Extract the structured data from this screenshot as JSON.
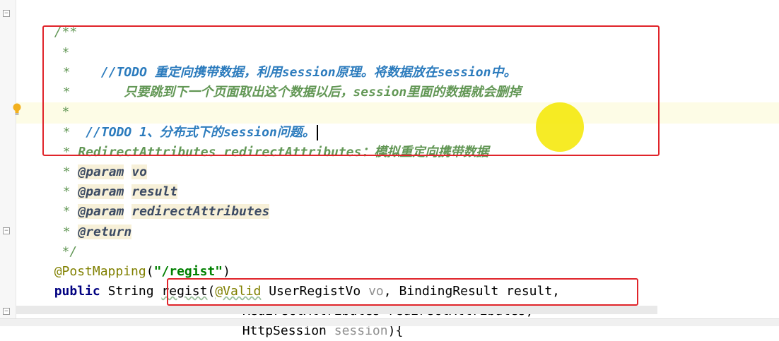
{
  "editor": {
    "lines": {
      "l1": "/**",
      "l2": " *",
      "l3_todo": "//TODO",
      "l3_text": "重定向携带数据，利用",
      "l3_session": "session",
      "l3_text2": "原理。将数据放在",
      "l3_session2": "session",
      "l3_text3": "中。",
      "l4_text": "只要跳到下一个页面取出这个数据以后，",
      "l4_session": "session",
      "l4_text2": "里面的数据就会删掉",
      "l5": " *",
      "l6_todo": "//TODO",
      "l6_num": "1",
      "l6_text": "、分布式下的",
      "l6_session": "session",
      "l6_text2": "问题。",
      "l7_code": "RedirectAttributes redirectAttributes",
      "l7_text": "：模拟重定向携带数据",
      "l8_tag": "@param",
      "l8_name": "vo",
      "l9_tag": "@param",
      "l9_name": "result",
      "l10_tag": "@param",
      "l10_name": "redirectAttributes",
      "l11_tag": "@return",
      "l12": " */",
      "l13_ann": "@PostMapping",
      "l13_open": "(",
      "l13_str": "\"/regist\"",
      "l13_close": ")",
      "l14_kw": "public",
      "l14_type": "String",
      "l14_method": "regist",
      "l14_ann": "@Valid",
      "l14_rest1": "UserRegistVo",
      "l14_vo": "vo",
      "l14_rest2": ", BindingResult result,",
      "l15": "RedirectAttributes redirectAttributes,",
      "l16_type": "HttpSession",
      "l16_var": "session",
      "l16_end": "){"
    }
  },
  "colors": {
    "highlight_box": "#e0242a",
    "comment": "#629755",
    "todo": "#2b7bbd",
    "cursor_highlight": "#f5e800"
  },
  "icons": {
    "intention": "lightbulb-icon",
    "fold": "fold-marker-icon"
  }
}
